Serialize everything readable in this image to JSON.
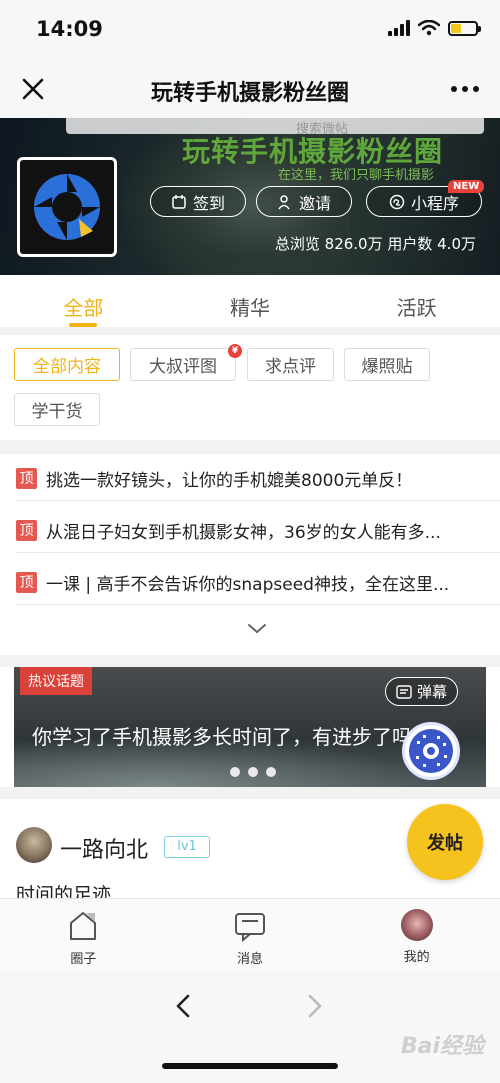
{
  "status": {
    "time": "14:09"
  },
  "nav": {
    "title": "玩转手机摄影粉丝圈"
  },
  "banner": {
    "search_placeholder": "搜索微帖",
    "big_title": "玩转手机摄影粉丝圈",
    "subtitle": "在这里，我们只聊手机摄影",
    "signin_label": "签到",
    "invite_label": "邀请",
    "miniprogram_label": "小程序",
    "new_badge": "NEW",
    "stats": "总浏览 826.0万  用户数 4.0万"
  },
  "tabs": [
    {
      "label": "全部",
      "active": true
    },
    {
      "label": "精华",
      "active": false
    },
    {
      "label": "活跃",
      "active": false
    }
  ],
  "filters": [
    {
      "label": "全部内容",
      "active": true
    },
    {
      "label": "大叔评图",
      "active": false
    },
    {
      "label": "求点评",
      "active": false
    },
    {
      "label": "爆照贴",
      "active": false
    },
    {
      "label": "学干货",
      "active": false
    }
  ],
  "filter_badge": "¥",
  "pinned": [
    {
      "badge": "顶",
      "text": "挑选一款好镜头，让你的手机媲美8000元单反！"
    },
    {
      "badge": "顶",
      "text": "从混日子妇女到手机摄影女神，36岁的女人能有多..."
    },
    {
      "badge": "顶",
      "text": "一课 | 高手不会告诉你的snapseed神技，全在这里..."
    }
  ],
  "topic": {
    "tag": "热议话题",
    "danmu_label": "弹幕",
    "text": "你学习了手机摄影多长时间了，有进步了吗"
  },
  "post": {
    "username": "一路向北",
    "level": "lv1",
    "text": "时间的足迹"
  },
  "post_button": "发帖",
  "tabbar": [
    {
      "label": "圈子",
      "icon": "circle-icon"
    },
    {
      "label": "消息",
      "icon": "message-icon"
    },
    {
      "label": "我的",
      "icon": "profile-avatar"
    }
  ],
  "watermark": "Bai经验",
  "colors": {
    "accent": "#f0b419",
    "pin_red": "#e5584f",
    "topic_red": "#d9423a",
    "post_yellow": "#f6c21d"
  }
}
